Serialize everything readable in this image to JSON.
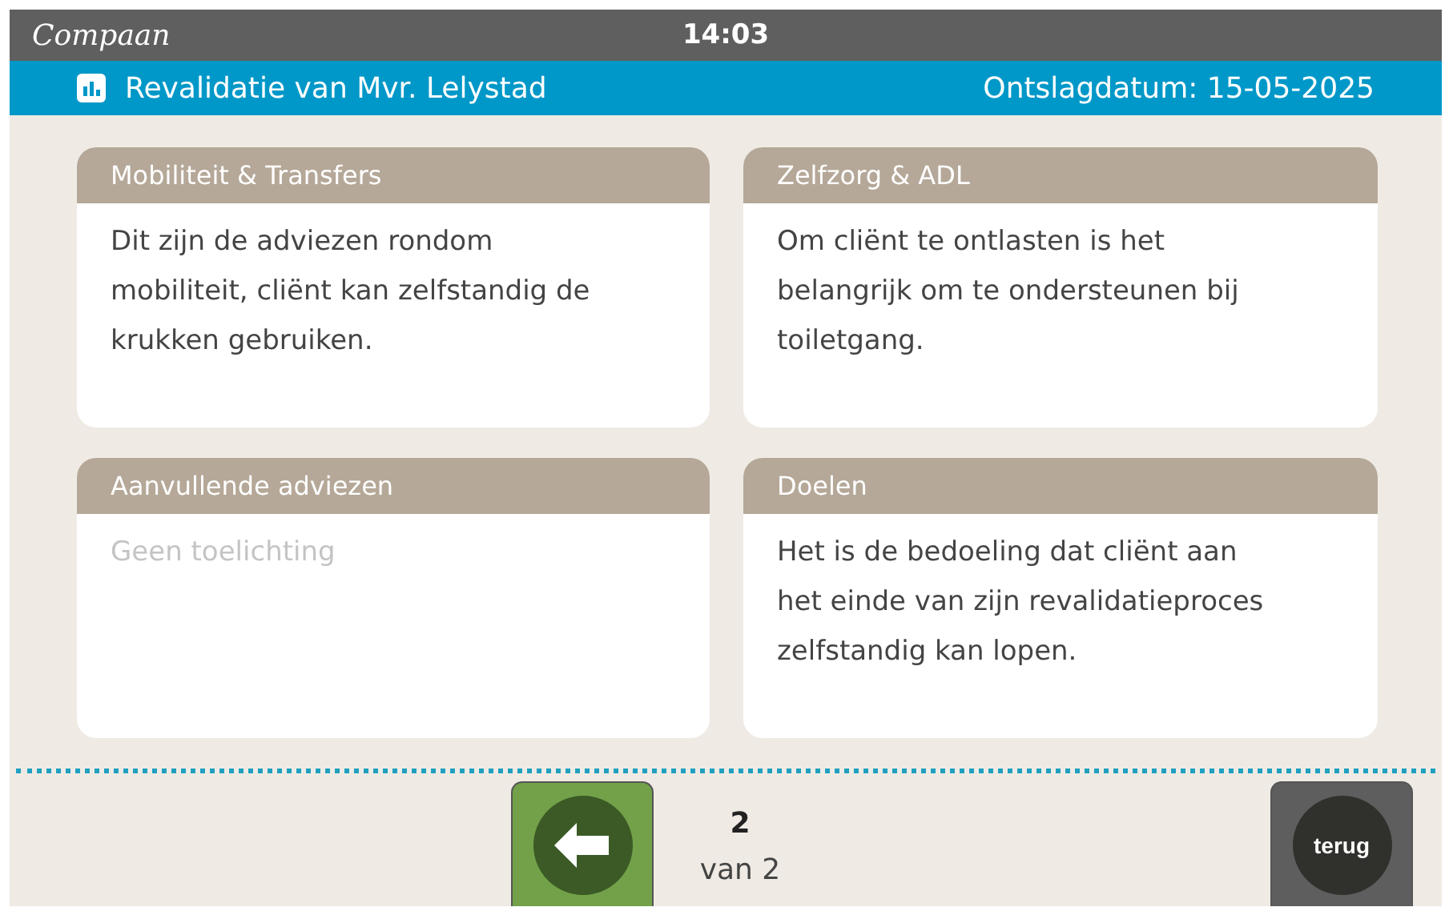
{
  "top_bar": {
    "logo": "Compaan",
    "time": "14:03"
  },
  "header": {
    "title": "Revalidatie van Mvr. Lelystad",
    "discharge": "Ontslagdatum: 15-05-2025"
  },
  "cards": [
    {
      "title": "Mobiliteit & Transfers",
      "text": "Dit zijn de adviezen rondom mobiliteit, cliënt kan zelfstandig de krukken gebruiken.",
      "empty": false
    },
    {
      "title": "Zelfzorg & ADL",
      "text": "Om cliënt te ontlasten is het belangrijk om te ondersteunen bij toiletgang.",
      "empty": false
    },
    {
      "title": "Aanvullende adviezen",
      "text": "Geen toelichting",
      "empty": true
    },
    {
      "title": "Doelen",
      "text": "Het is de bedoeling dat cliënt aan het einde van zijn revalidatieproces zelfstandig kan lopen.",
      "empty": false
    }
  ],
  "pager": {
    "current": "2",
    "total": "van 2"
  },
  "back_button": "terug"
}
